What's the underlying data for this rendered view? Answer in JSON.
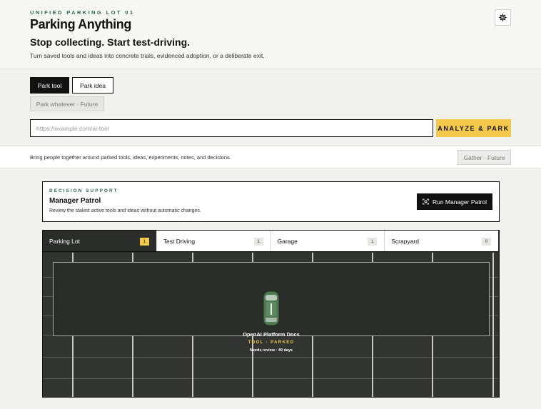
{
  "header": {
    "eyebrow": "UNIFIED PARKING LOT 01",
    "title": "Parking Anything",
    "tagline": "Stop collecting. Start test-driving.",
    "subline": "Turn saved tools and ideas into concrete trials, evidenced adoption, or a deliberate exit.",
    "settings_icon": "gear-icon"
  },
  "modes": {
    "tool": "Park tool",
    "idea": "Park idea",
    "future": "Park whatever · Future"
  },
  "url_input": {
    "placeholder": "https://example.com/ai-tool",
    "value": ""
  },
  "analyze_label": "ANALYZE & PARK",
  "collab": {
    "text": "Bring people together around parked tools, ideas, experiments, notes, and decisions.",
    "gather_label": "Gather · Future"
  },
  "patrol": {
    "eyebrow": "DECISION SUPPORT",
    "title": "Manager Patrol",
    "description": "Review the stalest active tools and ideas without automatic changes.",
    "button_label": "Run Manager Patrol",
    "button_icon": "scan-icon"
  },
  "tabs": [
    {
      "label": "Parking Lot",
      "count": "1"
    },
    {
      "label": "Test Driving",
      "count": "1"
    },
    {
      "label": "Garage",
      "count": "1"
    },
    {
      "label": "Scrapyard",
      "count": "0"
    }
  ],
  "parked_item": {
    "name": "OpenAI Platform Docs",
    "kind": "TOOL · PARKED",
    "status": "Needs review · 49 days",
    "color": "#4f7a52",
    "icon": "car-icon"
  },
  "colors": {
    "accent": "#f2c94c",
    "brand_green": "#2d6b4a",
    "asphalt": "#323432"
  }
}
